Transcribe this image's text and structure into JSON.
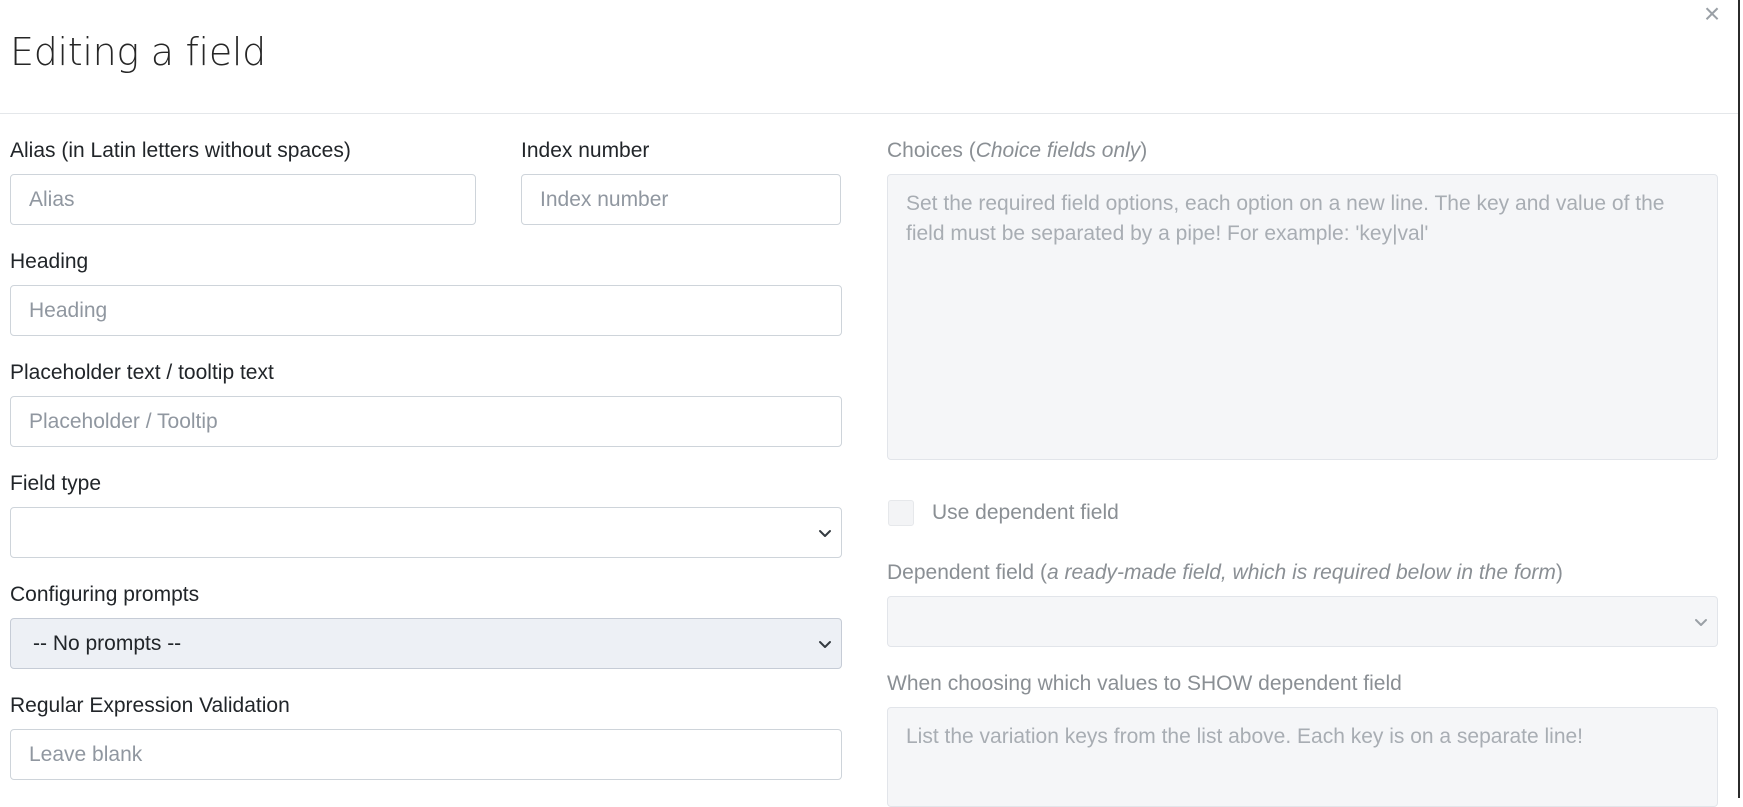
{
  "modal": {
    "title": "Editing a field",
    "close_symbol": "×"
  },
  "left": {
    "alias": {
      "label": "Alias (in Latin letters without spaces)",
      "placeholder": "Alias",
      "value": ""
    },
    "index": {
      "label": "Index number",
      "placeholder": "Index number",
      "value": ""
    },
    "heading": {
      "label": "Heading",
      "placeholder": "Heading",
      "value": ""
    },
    "placeholder_text": {
      "label": "Placeholder text / tooltip text",
      "placeholder": "Placeholder / Tooltip",
      "value": ""
    },
    "field_type": {
      "label": "Field type",
      "selected": ""
    },
    "prompts": {
      "label": "Configuring prompts",
      "selected": "-- No prompts --"
    },
    "regex": {
      "label": "Regular Expression Validation",
      "placeholder": "Leave blank",
      "value": ""
    }
  },
  "right": {
    "choices": {
      "label_prefix": "Choices (",
      "label_em": "Choice fields only",
      "label_suffix": ")",
      "placeholder": "Set the required field options, each option on a new line. The key and value of the field must be separated by a pipe! For example: 'key|val'"
    },
    "use_dependent": {
      "label": "Use dependent field",
      "checked": false
    },
    "dependent_field": {
      "label_prefix": "Dependent field (",
      "label_em": "a ready-made field, which is required below in the form",
      "label_suffix": ")",
      "selected": ""
    },
    "show_values": {
      "label": "When choosing which values to SHOW dependent field",
      "placeholder": "List the variation keys from the list above. Each key is on a separate line!"
    }
  },
  "icons": {
    "close": "close-icon",
    "chevron": "chevron-down-icon"
  }
}
